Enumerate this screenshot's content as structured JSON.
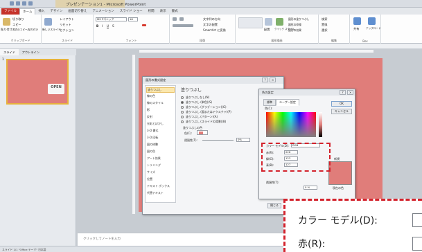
{
  "titlebar": {
    "title": "プレゼンテーション1 - Microsoft PowerPoint",
    "tabs": [
      "ファイル",
      "ホーム",
      "挿入",
      "デザイン",
      "画面切り替え",
      "アニメーション",
      "スライド ショー",
      "校閲",
      "表示",
      "書式"
    ]
  },
  "ribbon": {
    "clipboard": {
      "paste": "貼り付け",
      "cut": "切り取り",
      "copy": "コピー",
      "format_painter": "書式のコピー/貼り付け",
      "label": "クリップボード"
    },
    "slides": {
      "new_slide": "新しいスライド",
      "layout": "レイアウト",
      "reset": "リセット",
      "section": "セクション",
      "label": "スライド"
    },
    "font": {
      "name": "MS Pゴシック",
      "size": "18",
      "label": "フォント"
    },
    "paragraph": {
      "direction": "文字列の方向",
      "align": "文字の配置",
      "smartart": "SmartArt に変換",
      "label": "段落"
    },
    "drawing": {
      "arrange": "配置",
      "quick_styles": "クイック スタイル",
      "fill": "図形の塗りつぶし",
      "outline": "図形の枠線",
      "effects": "図形の効果",
      "label": "図形描画"
    },
    "editing": {
      "find": "検索",
      "replace": "置換",
      "select": "選択",
      "label": "編集"
    },
    "extra": {
      "share": "共有",
      "upload": "アップロード",
      "label": "Box"
    }
  },
  "leftpanel": {
    "tabs": [
      "スライド",
      "アウトライン"
    ],
    "slide_number": "1",
    "thumb_badge": "OPEN"
  },
  "notes": {
    "placeholder": "クリックしてノートを入力"
  },
  "statusbar": {
    "text": "スライド 1/1   \"Office テーマ\"   日本語"
  },
  "format_dialog": {
    "title": "図形の書式設定",
    "nav": [
      "塗りつぶし",
      "線の色",
      "線のスタイル",
      "影",
      "反射",
      "光彩とぼかし",
      "3-D 書式",
      "3-D 回転",
      "図の修整",
      "図の色",
      "アート効果",
      "トリミング",
      "サイズ",
      "位置",
      "テキスト ボックス",
      "代替テキスト"
    ],
    "selected_nav": "塗りつぶし",
    "heading": "塗りつぶし",
    "options": [
      "塗りつぶしなし(N)",
      "塗りつぶし (単色)(S)",
      "塗りつぶし (グラデーション)(G)",
      "塗りつぶし (図またはテクスチャ)(P)",
      "塗りつぶし (パターン)(A)",
      "塗りつぶし (スライドの背景)(B)"
    ],
    "selected_option": "塗りつぶし (単色)(S)",
    "color_section": "塗りつぶしの色",
    "color_label": "色(C):",
    "transparency_label": "透過性(T):",
    "transparency_value": "0%",
    "close_button": "閉じる"
  },
  "color_dialog": {
    "title": "色の設定",
    "tabs": [
      "標準",
      "ユーザー設定"
    ],
    "active_tab": "ユーザー設定",
    "color_label": "色(C):",
    "ok": "OK",
    "cancel": "キャンセル",
    "model_label": "カラー モデル(D):",
    "model_value": "RGB",
    "red_label": "赤(R):",
    "red_value": "226",
    "green_label": "緑(G):",
    "green_value": "123",
    "blue_label": "青(B):",
    "blue_value": "127",
    "transparency_label": "透過性(T):",
    "transparency_value": "0 %",
    "new_label": "新規",
    "current_label": "現在の色",
    "swatch_color": "#e07d7a"
  },
  "zoom": {
    "row1_label": "カラー モデル(D):",
    "row2_label": "赤(R):"
  },
  "colors": {
    "slide": "#e07d7a",
    "highlight": "#d3222c",
    "file_tab": "#c5322a"
  }
}
